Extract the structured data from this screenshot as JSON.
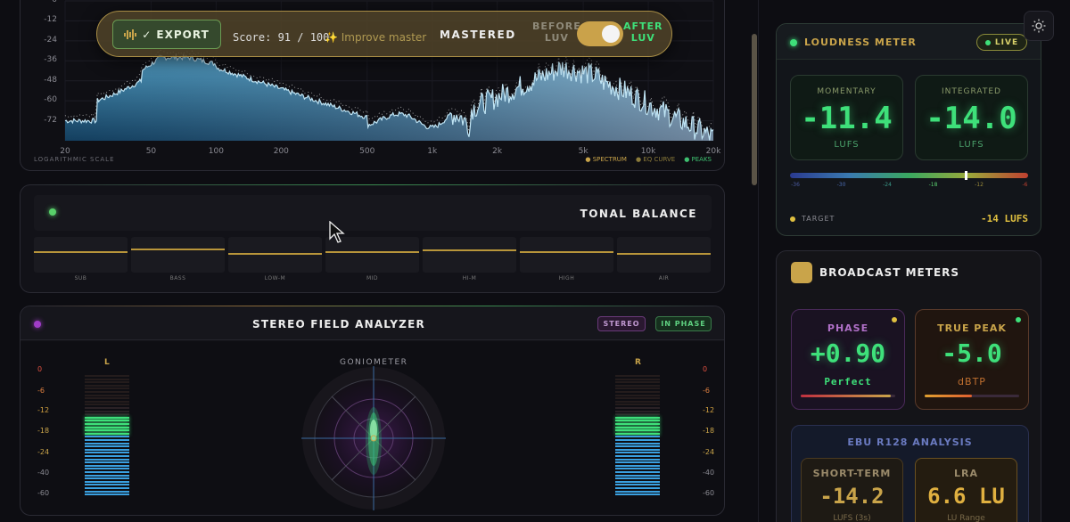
{
  "spectrum": {
    "y_ticks": [
      "0",
      "-12",
      "-24",
      "-36",
      "-48",
      "-60",
      "-72"
    ],
    "x_ticks": [
      "20",
      "50",
      "100",
      "200",
      "500",
      "1k",
      "2k",
      "5k",
      "10k",
      "20k"
    ],
    "scale_label": "LOGARITHMIC SCALE",
    "legend": {
      "spectrum": "● SPECTRUM",
      "eq": "● EQ CURVE",
      "peaks": "● PEAKS"
    },
    "colors": {
      "fill_top": "#5aaad0",
      "fill_bottom": "#123a5a",
      "line": "#bfe4f4",
      "peaks": "#e8e8e8"
    }
  },
  "toolbar": {
    "export_label": "✓ EXPORT",
    "score": "Score: 91 / 100",
    "improve_label": "✨ Improve master",
    "status": "MASTERED",
    "before_line1": "BEFORE",
    "before_line2": "LUV",
    "after_line1": "AFTER",
    "after_line2": "LUV",
    "toggle_on": true
  },
  "tonal_balance": {
    "title": "TONAL BALANCE",
    "bands": [
      {
        "label": "SUB",
        "level": 0.45
      },
      {
        "label": "BASS",
        "level": 0.35
      },
      {
        "label": "LOW-M",
        "level": 0.5
      },
      {
        "label": "MID",
        "level": 0.45
      },
      {
        "label": "HI-M",
        "level": 0.4
      },
      {
        "label": "HIGH",
        "level": 0.45
      },
      {
        "label": "AIR",
        "level": 0.5
      }
    ],
    "accent": "#b8953a"
  },
  "stereo": {
    "title": "STEREO FIELD ANALYZER",
    "badge_mode": "STEREO",
    "badge_phase": "IN PHASE",
    "left_label": "L",
    "right_label": "R",
    "goniometer_label": "GONIOMETER",
    "db_scale": [
      "0",
      "-6",
      "-12",
      "-18",
      "-24",
      "-40",
      "-60"
    ],
    "left_level": 0.66,
    "right_level": 0.66
  },
  "loudness": {
    "title": "LOUDNESS METER",
    "live_label": "LIVE",
    "momentary_label": "MOMENTARY",
    "momentary_value": "-11.4",
    "integrated_label": "INTEGRATED",
    "integrated_value": "-14.0",
    "unit": "LUFS",
    "scale_ticks": [
      "-36",
      "-30",
      "-24",
      "-18",
      "-12",
      "-6"
    ],
    "target_label": "TARGET",
    "target_value": "-14 LUFS"
  },
  "broadcast": {
    "title": "BROADCAST METERS",
    "phase_label": "PHASE",
    "phase_value": "+0.90",
    "phase_sub": "Perfect",
    "phase_level": 0.95,
    "truepeak_label": "TRUE PEAK",
    "truepeak_value": "-5.0",
    "truepeak_unit": "dBTP",
    "truepeak_level": 0.5,
    "ebu_title": "EBU R128 ANALYSIS",
    "short_term_label": "SHORT-TERM",
    "short_term_value": "-14.2",
    "short_term_unit": "LUFS (3s)",
    "lra_label": "LRA",
    "lra_value": "6.6 LU",
    "lra_unit": "LU Range"
  },
  "icons": {
    "theme": "sun-icon",
    "cursor": "cursor-arrow-icon",
    "export": "waveform-icon"
  }
}
